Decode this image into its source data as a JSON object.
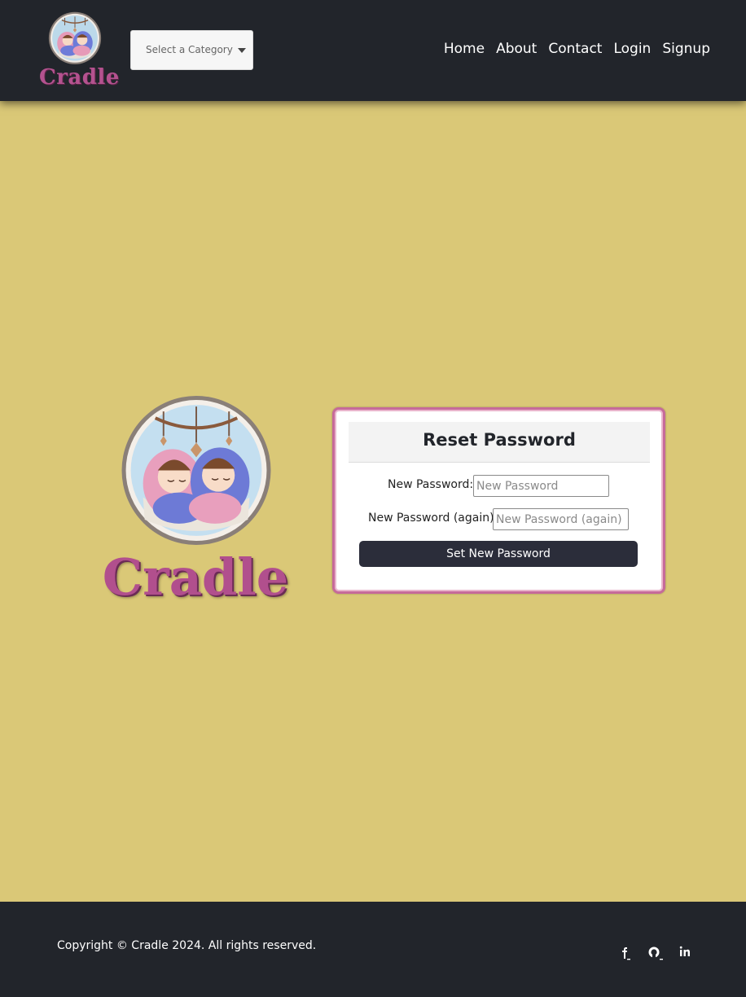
{
  "header": {
    "brand_name": "Cradle",
    "category": {
      "selected": "Select a Category"
    },
    "nav": [
      "Home",
      "About",
      "Contact",
      "Login",
      "Signup"
    ]
  },
  "hero": {
    "brand_name": "Cradle"
  },
  "form": {
    "title": "Reset Password",
    "new_password_label": "New Password:",
    "new_password_placeholder": "New Password",
    "new_password_again_label": "New Password (again):",
    "new_password_again_placeholder": "New Password (again)",
    "submit_label": "Set New Password"
  },
  "footer": {
    "copyright": "Copyright © Cradle 2024. All rights reserved.",
    "social_icons": [
      "facebook-icon",
      "github-icon",
      "linkedin-icon"
    ]
  },
  "colors": {
    "background": "#dac877",
    "header_bg": "#22252b",
    "accent_pink": "#b14f8d",
    "button_bg": "#2b2d3a"
  }
}
